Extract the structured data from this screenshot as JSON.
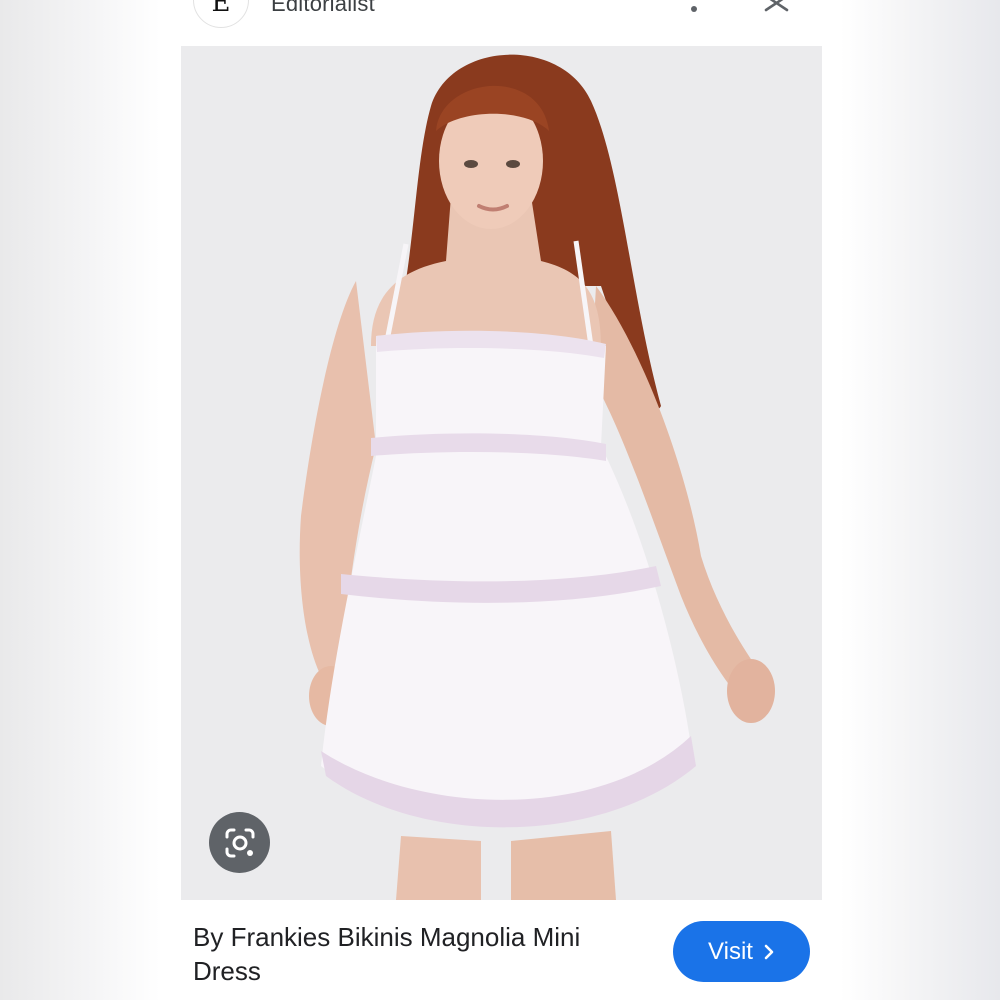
{
  "header": {
    "site_logo_letter": "E",
    "site_name": "Editorialist",
    "more_icon": "more-vert-icon",
    "close_icon": "close-icon"
  },
  "image": {
    "description_icon": "product-photo",
    "lens_icon": "google-lens-icon"
  },
  "footer": {
    "product_title": "By Frankies Bikinis Magnolia Mini Dress",
    "visit_label": "Visit",
    "visit_icon": "chevron-right-icon"
  },
  "colors": {
    "accent": "#1a73e8",
    "lens_button": "#5f6368",
    "image_background": "#ebebed"
  }
}
